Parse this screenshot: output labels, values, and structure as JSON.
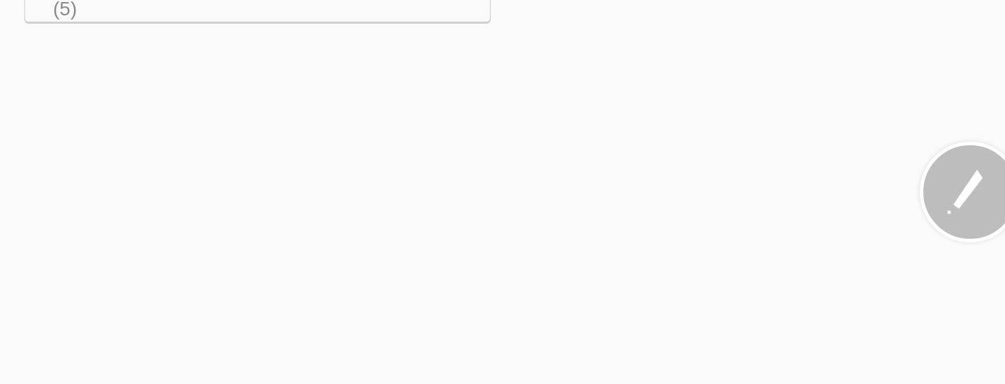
{
  "card": {
    "count": "(5)"
  },
  "fab": {
    "kind": "edit"
  }
}
